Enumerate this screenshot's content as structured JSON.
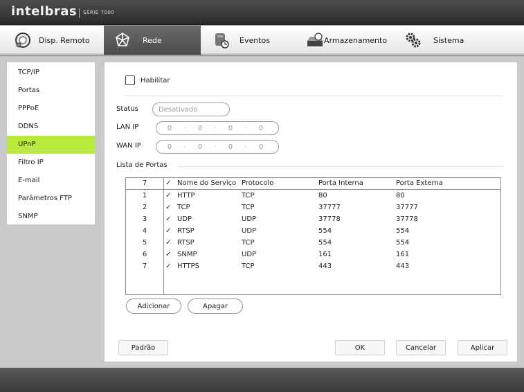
{
  "header": {
    "brand": "intelbras",
    "series": "SÉRIE 7000"
  },
  "nav": [
    {
      "label": "Disp. Remoto",
      "icon": "remote-device-icon"
    },
    {
      "label": "Rede",
      "icon": "network-icon"
    },
    {
      "label": "Eventos",
      "icon": "events-icon"
    },
    {
      "label": "Armazenamento",
      "icon": "storage-icon"
    },
    {
      "label": "Sistema",
      "icon": "system-gears-icon"
    }
  ],
  "sidebar": [
    {
      "label": "TCP/IP"
    },
    {
      "label": "Portas"
    },
    {
      "label": "PPPoE"
    },
    {
      "label": "DDNS"
    },
    {
      "label": "UPnP"
    },
    {
      "label": "Filtro IP"
    },
    {
      "label": "E-mail"
    },
    {
      "label": "Parâmetros FTP"
    },
    {
      "label": "SNMP"
    }
  ],
  "form": {
    "enable_label": "Habilitar",
    "status_label": "Status",
    "status_value": "Desativado",
    "lan_label": "LAN IP",
    "lan_ip": [
      "0",
      "0",
      "0",
      "0"
    ],
    "wan_label": "WAN IP",
    "wan_ip": [
      "0",
      "0",
      "0",
      "0"
    ],
    "ports_list_title": "Lista de Portas"
  },
  "table": {
    "count": "7",
    "headers": {
      "service": "Nome do Serviço",
      "protocol": "Protocolo",
      "internal": "Porta Interna",
      "external": "Porta Externa"
    },
    "rows": [
      {
        "n": "1",
        "service": "HTTP",
        "protocol": "TCP",
        "internal": "80",
        "external": "80"
      },
      {
        "n": "2",
        "service": "TCP",
        "protocol": "TCP",
        "internal": "37777",
        "external": "37777"
      },
      {
        "n": "3",
        "service": "UDP",
        "protocol": "UDP",
        "internal": "37778",
        "external": "37778"
      },
      {
        "n": "4",
        "service": "RTSP",
        "protocol": "UDP",
        "internal": "554",
        "external": "554"
      },
      {
        "n": "5",
        "service": "RTSP",
        "protocol": "TCP",
        "internal": "554",
        "external": "554"
      },
      {
        "n": "6",
        "service": "SNMP",
        "protocol": "UDP",
        "internal": "161",
        "external": "161"
      },
      {
        "n": "7",
        "service": "HTTPS",
        "protocol": "TCP",
        "internal": "443",
        "external": "443"
      }
    ]
  },
  "buttons": {
    "add": "Adicionar",
    "delete": "Apagar",
    "default": "Padrão",
    "ok": "OK",
    "cancel": "Cancelar",
    "apply": "Aplicar"
  },
  "colors": {
    "active_sidebar": "#b7ea3a",
    "active_nav": "#5a5a5a"
  }
}
